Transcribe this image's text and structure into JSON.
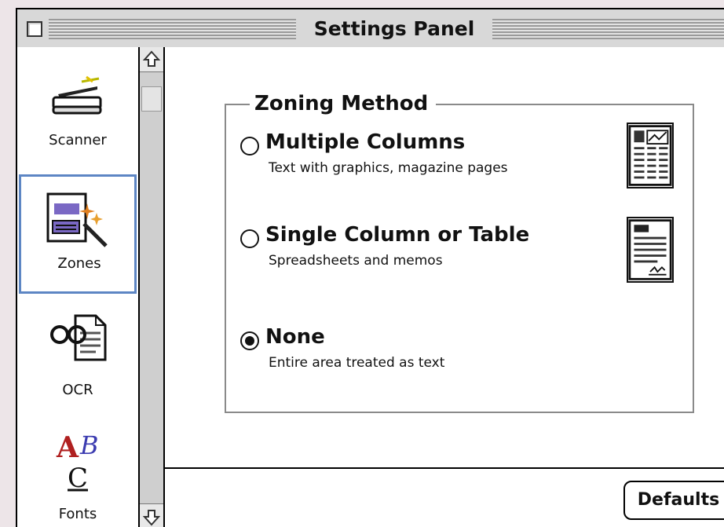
{
  "window": {
    "title": "Settings Panel"
  },
  "sidebar": {
    "items": [
      {
        "label": "Scanner",
        "icon": "scanner-icon"
      },
      {
        "label": "Zones",
        "icon": "zones-icon",
        "selected": true
      },
      {
        "label": "OCR",
        "icon": "ocr-icon"
      },
      {
        "label": "Fonts",
        "icon": "fonts-icon"
      }
    ]
  },
  "zoning": {
    "title": "Zoning Method",
    "options": [
      {
        "label": "Multiple Columns",
        "description": "Text with graphics, magazine pages",
        "checked": false,
        "icon": "multi-column-page-icon"
      },
      {
        "label": "Single Column or Table",
        "description": "Spreadsheets and memos",
        "checked": false,
        "icon": "single-column-page-icon"
      },
      {
        "label": "None",
        "description": "Entire area treated as text",
        "checked": true
      }
    ]
  },
  "footer": {
    "defaults_label": "Defaults"
  },
  "colors": {
    "selection_border": "#5d86c4",
    "window_background": "#ffffff",
    "desktop": "#ede5e8"
  }
}
